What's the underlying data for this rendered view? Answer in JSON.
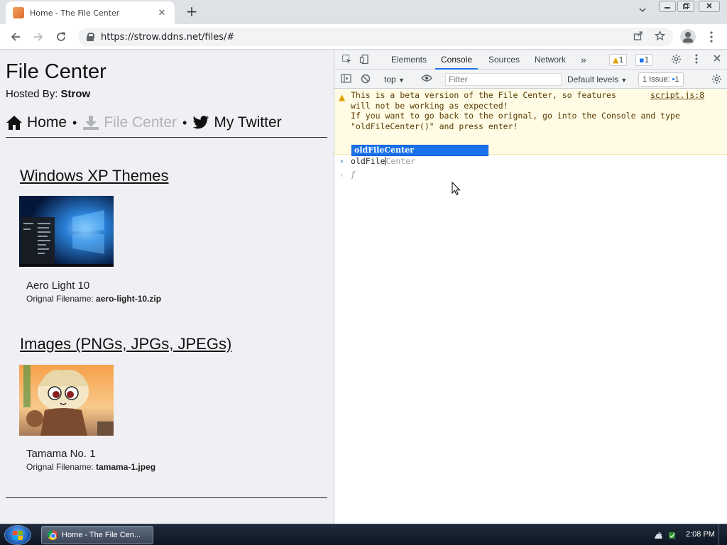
{
  "browser": {
    "tab_title": "Home - The File Center",
    "tab_close": "✕",
    "new_tab": "+",
    "url": "https://strow.ddns.net/files/#",
    "colors": {
      "accent": "#1a73e8",
      "toolbar": "#ffffff",
      "tabstrip": "#dee1e6"
    }
  },
  "page": {
    "title": "File Center",
    "hosted_label": "Hosted By: ",
    "hosted_name": "Strow",
    "nav": [
      {
        "label": "Home",
        "icon": "home-icon",
        "active": false
      },
      {
        "label": "File Center",
        "icon": "download-icon",
        "active": true
      },
      {
        "label": "My Twitter",
        "icon": "twitter-bird-icon",
        "active": false
      }
    ],
    "nav_separator": "•",
    "sections": [
      {
        "heading": "Windows XP Themes",
        "item_name": "Aero Light 10",
        "filename_label": "Orignal Filename: ",
        "filename": "aero-light-10.zip"
      },
      {
        "heading": "Images (PNGs, JPGs, JPEGs)",
        "item_name": "Tamama No. 1",
        "filename_label": "Orignal Filename: ",
        "filename": "tamama-1.jpeg"
      }
    ]
  },
  "devtools": {
    "tabs": [
      "Elements",
      "Console",
      "Sources",
      "Network"
    ],
    "active_tab": "Console",
    "more_tabs": "»",
    "warnings_count": "1",
    "messages_count": "1",
    "context": "top",
    "filter_placeholder": "Filter",
    "levels": "Default levels",
    "issues": "1 Issue:",
    "issues_count": "1",
    "warning_message": "This is a beta version of the File Center, so features\nwill not be working as expected!\nIf you want to go back to the orignal, go into the Console and type\n\"oldFileCenter()\" and press enter!",
    "warning_source": "script.js:8",
    "autocomplete_suggestion": "oldFileCenter",
    "input_typed": "oldFile",
    "input_ghost": "Center",
    "result_symbol": "f"
  },
  "taskbar": {
    "window_label": "Home - The File Cen...",
    "clock": "2:08 PM"
  }
}
